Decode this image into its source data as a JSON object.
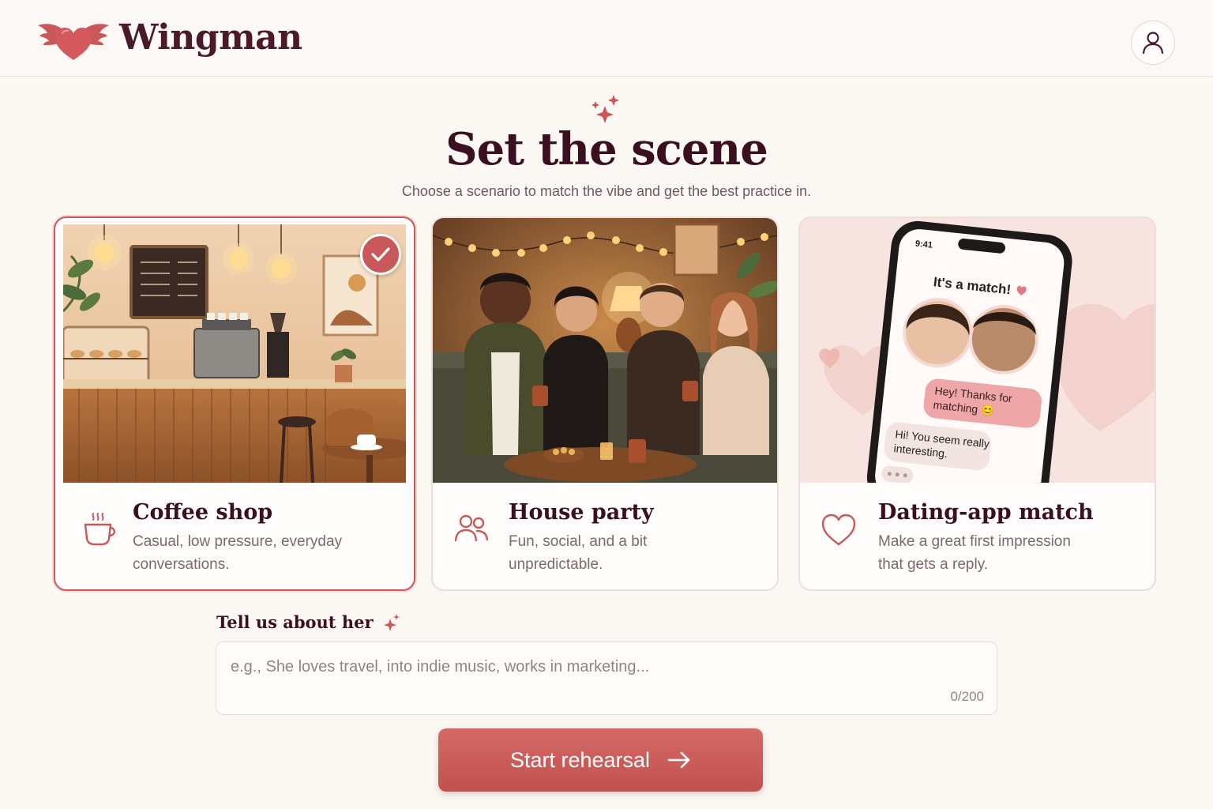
{
  "app": {
    "brand": "Wingman"
  },
  "colors": {
    "accent": "#c9585a",
    "title": "#3a0f1f",
    "background": "#fbf7f3"
  },
  "hero": {
    "title": "Set the scene",
    "subtitle": "Choose a scenario to match the vibe and get the best practice in."
  },
  "scenarios": [
    {
      "title": "Coffee shop",
      "desc_line1": "Casual, low pressure, everyday",
      "desc_line2": "conversations.",
      "icon": "coffee-cup-icon",
      "selected": true
    },
    {
      "title": "House party",
      "desc_line1": "Fun, social, and a bit",
      "desc_line2": "unpredictable.",
      "icon": "people-icon",
      "selected": false
    },
    {
      "title": "Dating-app match",
      "desc_line1": "Make a great first impression",
      "desc_line2": "that gets a reply.",
      "icon": "heart-icon",
      "selected": false
    }
  ],
  "phone": {
    "time": "9:41",
    "match_text": "It's a match!",
    "bubble_1": "Hey! Thanks for",
    "bubble_1b": "matching 😊",
    "bubble_2": "Hi! You seem really",
    "bubble_2b": "interesting."
  },
  "about": {
    "label": "Tell us about her",
    "placeholder": "e.g., She loves travel, into indie music, works in marketing...",
    "value": "",
    "counter": "0/200"
  },
  "cta": {
    "label": "Start rehearsal"
  }
}
